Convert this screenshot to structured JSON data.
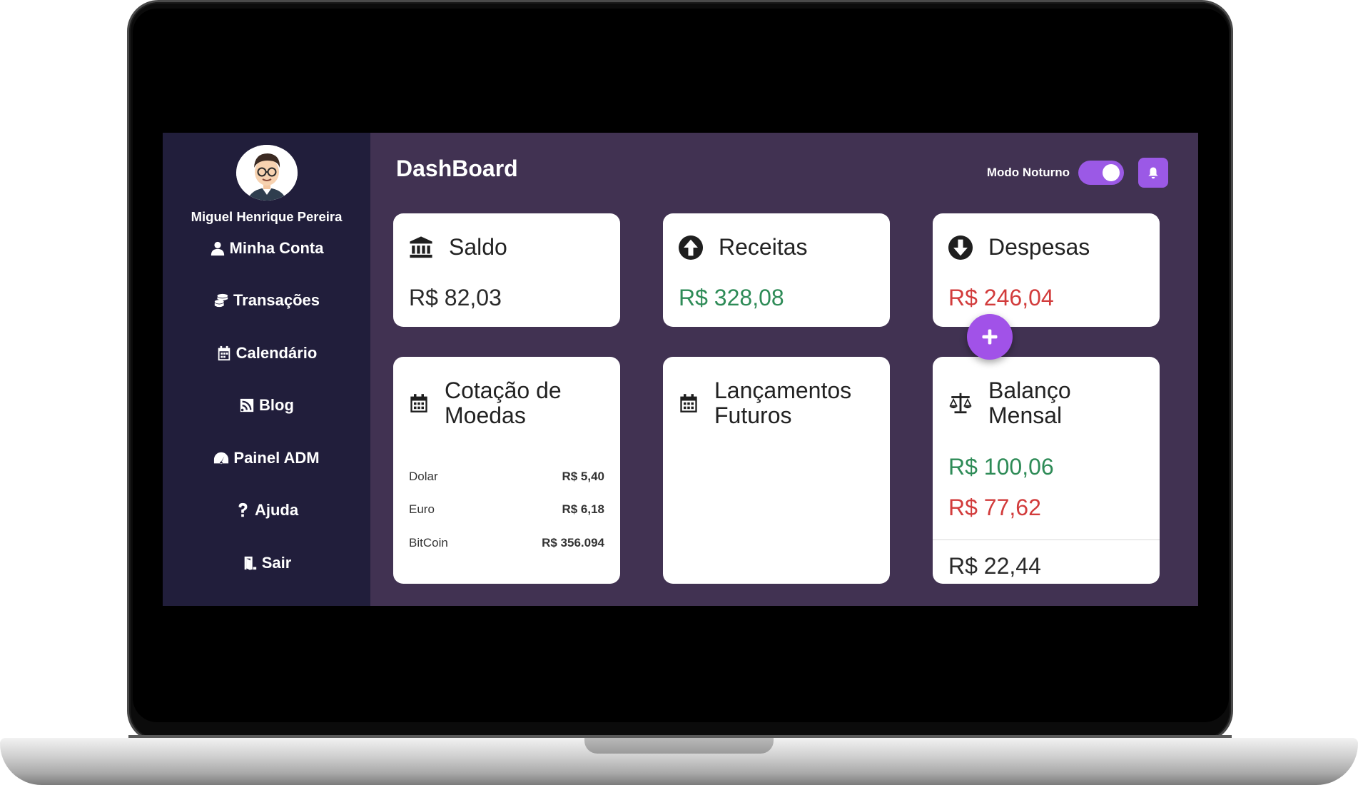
{
  "user": {
    "name": "Miguel Henrique Pereira"
  },
  "sidebar": {
    "items": [
      {
        "label": "Minha Conta",
        "icon": "user-icon"
      },
      {
        "label": "Transações",
        "icon": "coins-icon"
      },
      {
        "label": "Calendário",
        "icon": "calendar-icon"
      },
      {
        "label": "Blog",
        "icon": "rss-icon"
      },
      {
        "label": "Painel ADM",
        "icon": "gauge-icon"
      },
      {
        "label": "Ajuda",
        "icon": "question-icon"
      },
      {
        "label": "Sair",
        "icon": "door-exit-icon"
      }
    ]
  },
  "header": {
    "title": "DashBoard",
    "night_mode_label": "Modo Noturno",
    "night_mode_on": true
  },
  "cards": {
    "saldo": {
      "title": "Saldo",
      "value": "R$ 82,03"
    },
    "receitas": {
      "title": "Receitas",
      "value": "R$ 328,08"
    },
    "despesas": {
      "title": "Despesas",
      "value": "R$ 246,04"
    },
    "cotacao": {
      "title_line1": "Cotação de",
      "title_line2": "Moedas",
      "rates": [
        {
          "name": "Dolar",
          "value": "R$ 5,40"
        },
        {
          "name": "Euro",
          "value": "R$ 6,18"
        },
        {
          "name": "BitCoin",
          "value": "R$ 356.094"
        }
      ]
    },
    "lancamentos": {
      "title_line1": "Lançamentos",
      "title_line2": "Futuros"
    },
    "balanco": {
      "title_line1": "Balanço",
      "title_line2": "Mensal",
      "income": "R$ 100,06",
      "expense": "R$ 77,62",
      "total": "R$ 22,44"
    }
  },
  "colors": {
    "sidebar_bg": "#211e3b",
    "main_bg": "#413252",
    "accent": "#9b59e6",
    "positive": "#2e8b57",
    "negative": "#d23c3c"
  }
}
